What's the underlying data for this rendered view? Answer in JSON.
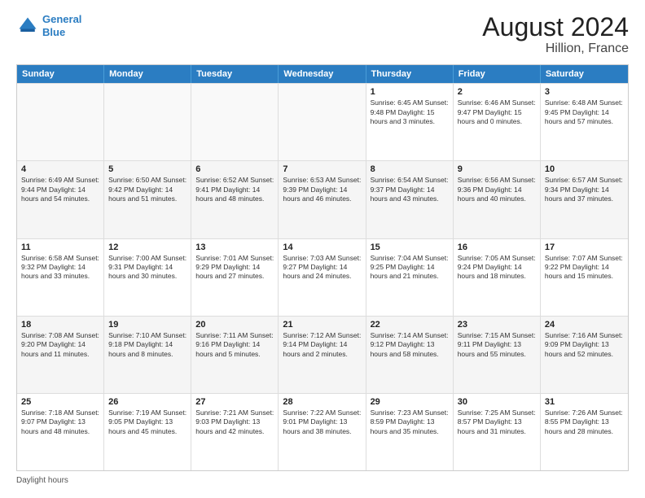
{
  "logo": {
    "line1": "General",
    "line2": "Blue"
  },
  "title": "August 2024",
  "subtitle": "Hillion, France",
  "days_of_week": [
    "Sunday",
    "Monday",
    "Tuesday",
    "Wednesday",
    "Thursday",
    "Friday",
    "Saturday"
  ],
  "footer": "Daylight hours",
  "weeks": [
    [
      {
        "day": "",
        "info": ""
      },
      {
        "day": "",
        "info": ""
      },
      {
        "day": "",
        "info": ""
      },
      {
        "day": "",
        "info": ""
      },
      {
        "day": "1",
        "info": "Sunrise: 6:45 AM\nSunset: 9:48 PM\nDaylight: 15 hours\nand 3 minutes."
      },
      {
        "day": "2",
        "info": "Sunrise: 6:46 AM\nSunset: 9:47 PM\nDaylight: 15 hours\nand 0 minutes."
      },
      {
        "day": "3",
        "info": "Sunrise: 6:48 AM\nSunset: 9:45 PM\nDaylight: 14 hours\nand 57 minutes."
      }
    ],
    [
      {
        "day": "4",
        "info": "Sunrise: 6:49 AM\nSunset: 9:44 PM\nDaylight: 14 hours\nand 54 minutes."
      },
      {
        "day": "5",
        "info": "Sunrise: 6:50 AM\nSunset: 9:42 PM\nDaylight: 14 hours\nand 51 minutes."
      },
      {
        "day": "6",
        "info": "Sunrise: 6:52 AM\nSunset: 9:41 PM\nDaylight: 14 hours\nand 48 minutes."
      },
      {
        "day": "7",
        "info": "Sunrise: 6:53 AM\nSunset: 9:39 PM\nDaylight: 14 hours\nand 46 minutes."
      },
      {
        "day": "8",
        "info": "Sunrise: 6:54 AM\nSunset: 9:37 PM\nDaylight: 14 hours\nand 43 minutes."
      },
      {
        "day": "9",
        "info": "Sunrise: 6:56 AM\nSunset: 9:36 PM\nDaylight: 14 hours\nand 40 minutes."
      },
      {
        "day": "10",
        "info": "Sunrise: 6:57 AM\nSunset: 9:34 PM\nDaylight: 14 hours\nand 37 minutes."
      }
    ],
    [
      {
        "day": "11",
        "info": "Sunrise: 6:58 AM\nSunset: 9:32 PM\nDaylight: 14 hours\nand 33 minutes."
      },
      {
        "day": "12",
        "info": "Sunrise: 7:00 AM\nSunset: 9:31 PM\nDaylight: 14 hours\nand 30 minutes."
      },
      {
        "day": "13",
        "info": "Sunrise: 7:01 AM\nSunset: 9:29 PM\nDaylight: 14 hours\nand 27 minutes."
      },
      {
        "day": "14",
        "info": "Sunrise: 7:03 AM\nSunset: 9:27 PM\nDaylight: 14 hours\nand 24 minutes."
      },
      {
        "day": "15",
        "info": "Sunrise: 7:04 AM\nSunset: 9:25 PM\nDaylight: 14 hours\nand 21 minutes."
      },
      {
        "day": "16",
        "info": "Sunrise: 7:05 AM\nSunset: 9:24 PM\nDaylight: 14 hours\nand 18 minutes."
      },
      {
        "day": "17",
        "info": "Sunrise: 7:07 AM\nSunset: 9:22 PM\nDaylight: 14 hours\nand 15 minutes."
      }
    ],
    [
      {
        "day": "18",
        "info": "Sunrise: 7:08 AM\nSunset: 9:20 PM\nDaylight: 14 hours\nand 11 minutes."
      },
      {
        "day": "19",
        "info": "Sunrise: 7:10 AM\nSunset: 9:18 PM\nDaylight: 14 hours\nand 8 minutes."
      },
      {
        "day": "20",
        "info": "Sunrise: 7:11 AM\nSunset: 9:16 PM\nDaylight: 14 hours\nand 5 minutes."
      },
      {
        "day": "21",
        "info": "Sunrise: 7:12 AM\nSunset: 9:14 PM\nDaylight: 14 hours\nand 2 minutes."
      },
      {
        "day": "22",
        "info": "Sunrise: 7:14 AM\nSunset: 9:12 PM\nDaylight: 13 hours\nand 58 minutes."
      },
      {
        "day": "23",
        "info": "Sunrise: 7:15 AM\nSunset: 9:11 PM\nDaylight: 13 hours\nand 55 minutes."
      },
      {
        "day": "24",
        "info": "Sunrise: 7:16 AM\nSunset: 9:09 PM\nDaylight: 13 hours\nand 52 minutes."
      }
    ],
    [
      {
        "day": "25",
        "info": "Sunrise: 7:18 AM\nSunset: 9:07 PM\nDaylight: 13 hours\nand 48 minutes."
      },
      {
        "day": "26",
        "info": "Sunrise: 7:19 AM\nSunset: 9:05 PM\nDaylight: 13 hours\nand 45 minutes."
      },
      {
        "day": "27",
        "info": "Sunrise: 7:21 AM\nSunset: 9:03 PM\nDaylight: 13 hours\nand 42 minutes."
      },
      {
        "day": "28",
        "info": "Sunrise: 7:22 AM\nSunset: 9:01 PM\nDaylight: 13 hours\nand 38 minutes."
      },
      {
        "day": "29",
        "info": "Sunrise: 7:23 AM\nSunset: 8:59 PM\nDaylight: 13 hours\nand 35 minutes."
      },
      {
        "day": "30",
        "info": "Sunrise: 7:25 AM\nSunset: 8:57 PM\nDaylight: 13 hours\nand 31 minutes."
      },
      {
        "day": "31",
        "info": "Sunrise: 7:26 AM\nSunset: 8:55 PM\nDaylight: 13 hours\nand 28 minutes."
      }
    ]
  ]
}
